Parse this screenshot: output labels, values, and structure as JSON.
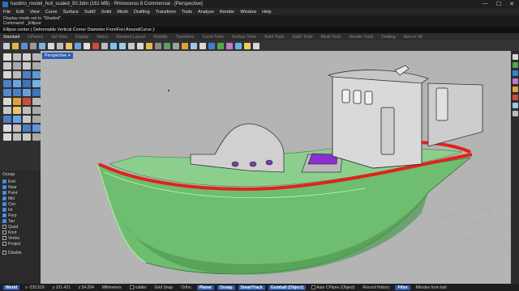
{
  "window": {
    "title": "hasbrio_model_hull_scaled_50.3dm (161 MB) - Rhinoceros 8 Commercial - [Perspective]",
    "controls": [
      "—",
      "☐",
      "✕"
    ]
  },
  "menu": [
    "File",
    "Edit",
    "View",
    "Curve",
    "Surface",
    "SubD",
    "Solid",
    "Mesh",
    "Drafting",
    "Transform",
    "Tools",
    "Analyze",
    "Render",
    "Window",
    "Help"
  ],
  "command_history": [
    "Display mode set to \"Shaded\".",
    "Command: _Ellipse"
  ],
  "command_prompt": "Ellipse center ( Deformable  Vertical  Corner  Diameter  FromFoci  AroundCurve ):",
  "tabs": {
    "items": [
      "Standard",
      "CPlanes",
      "Set View",
      "Display",
      "Select",
      "Viewport Layout",
      "Visibility",
      "Transform",
      "Curve Tools",
      "Surface Tools",
      "Solid Tools",
      "SubD Tools",
      "Mesh Tools",
      "Render Tools",
      "Drafting",
      "New in V8"
    ],
    "active_index": 0
  },
  "viewport": {
    "label": "Perspective",
    "background": "#b4b4b4",
    "hull_color": "#6fbd71",
    "rail_color": "#e0231b",
    "cabin_color": "#d6d6d6"
  },
  "osnap": {
    "header": "Osnap",
    "items": [
      {
        "label": "End",
        "checked": true
      },
      {
        "label": "Near",
        "checked": true
      },
      {
        "label": "Point",
        "checked": true
      },
      {
        "label": "Mid",
        "checked": true
      },
      {
        "label": "Cen",
        "checked": true
      },
      {
        "label": "Int",
        "checked": true
      },
      {
        "label": "Perp",
        "checked": true
      },
      {
        "label": "Tan",
        "checked": true
      },
      {
        "label": "Quad",
        "checked": false
      },
      {
        "label": "Knot",
        "checked": false
      },
      {
        "label": "Vertex",
        "checked": false
      },
      {
        "label": "Project",
        "checked": false
      }
    ],
    "disable_label": "Disable"
  },
  "status": {
    "cplane": "World",
    "x": "x -235.519",
    "y": "y 101.421",
    "z": "z 54.294",
    "units": "Millimeters",
    "layer": "rudder",
    "grid_snap": "Grid Snap",
    "ortho": "Ortho",
    "planar": "Planar",
    "osnap": "Osnap",
    "smarttrack": "SmartTrack",
    "gumball": "Gumball (Object)",
    "auto_cplane": "Auto CPlane (Object)",
    "record_history": "Record History",
    "filter": "Filter",
    "minutes": "Minutes from last"
  },
  "colors": {
    "accent": "#2a5db0"
  }
}
